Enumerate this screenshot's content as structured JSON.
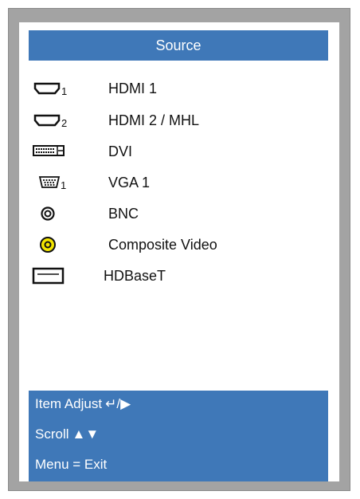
{
  "menu": {
    "title": "Source",
    "items": [
      {
        "label": "HDMI 1",
        "icon": "hdmi-1-icon",
        "subscript": "1"
      },
      {
        "label": "HDMI 2 / MHL",
        "icon": "hdmi-2-icon",
        "subscript": "2"
      },
      {
        "label": "DVI",
        "icon": "dvi-icon"
      },
      {
        "label": "VGA 1",
        "icon": "vga-1-icon",
        "subscript": "1"
      },
      {
        "label": "BNC",
        "icon": "bnc-icon"
      },
      {
        "label": "Composite Video",
        "icon": "composite-video-icon"
      },
      {
        "label": "HDBaseT",
        "icon": "hdbaset-icon"
      }
    ]
  },
  "help": {
    "item_adjust_label": "Item Adjust",
    "item_adjust_glyphs": "↵/▶",
    "scroll_label": "Scroll",
    "scroll_glyphs": "▲▼",
    "menu_exit_label": "Menu = Exit"
  },
  "colors": {
    "accent": "#3f78b8",
    "frame": "#a3a3a3",
    "composite_yellow": "#f4e600"
  }
}
